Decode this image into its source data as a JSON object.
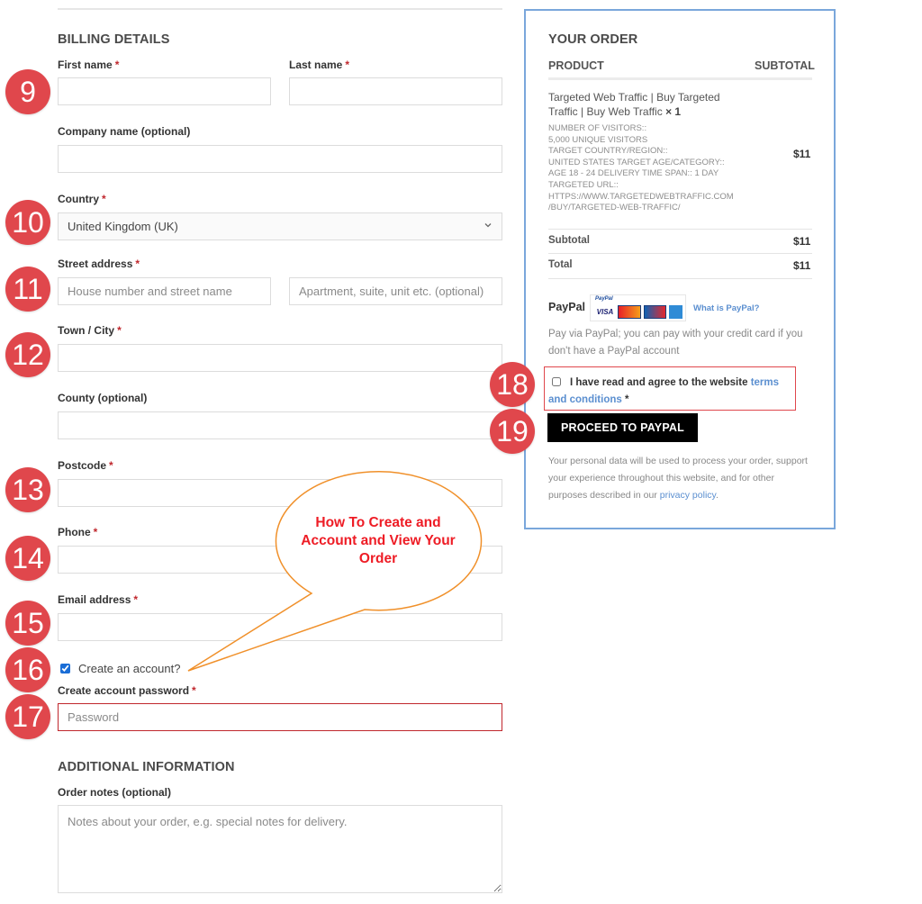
{
  "billing": {
    "heading": "BILLING DETAILS",
    "required_mark": "*",
    "first_name": {
      "label": "First name",
      "value": "",
      "placeholder": ""
    },
    "last_name": {
      "label": "Last name",
      "value": "",
      "placeholder": ""
    },
    "company": {
      "label": "Company name (optional)",
      "value": ""
    },
    "country": {
      "label": "Country",
      "selected": "United Kingdom (UK)"
    },
    "street": {
      "label": "Street address",
      "line1_placeholder": "House number and street name",
      "line2_placeholder": "Apartment, suite, unit etc. (optional)"
    },
    "town": {
      "label": "Town / City",
      "value": ""
    },
    "county": {
      "label": "County (optional)",
      "value": ""
    },
    "postcode": {
      "label": "Postcode",
      "value": ""
    },
    "phone": {
      "label": "Phone",
      "value": ""
    },
    "email": {
      "label": "Email address",
      "value": ""
    },
    "create_account": {
      "label": "Create an account?",
      "checked": true
    },
    "password": {
      "label": "Create account password",
      "placeholder": "Password"
    }
  },
  "additional": {
    "heading": "ADDITIONAL INFORMATION",
    "notes_label": "Order notes (optional)",
    "notes_placeholder": "Notes about your order, e.g. special notes for delivery."
  },
  "order": {
    "heading": "YOUR ORDER",
    "col_product": "PRODUCT",
    "col_subtotal": "SUBTOTAL",
    "product_name": "Targeted Web Traffic | Buy Targeted Traffic | Buy Web Traffic",
    "quantity": "× 1",
    "product_meta": "NUMBER OF VISITORS::\n5,000 UNIQUE VISITORS\nTARGET COUNTRY/REGION::\nUNITED STATES   TARGET AGE/CATEGORY::\nAGE 18 - 24   DELIVERY TIME SPAN::   1 DAY\nTARGETED URL::\nHTTPS://WWW.TARGETEDWEBTRAFFIC.COM\n/BUY/TARGETED-WEB-TRAFFIC/",
    "line_price": "$11",
    "subtotal_label": "Subtotal",
    "subtotal_value": "$11",
    "total_label": "Total",
    "total_value": "$11"
  },
  "payment": {
    "method": "PayPal",
    "logo_mark": "PayPal",
    "cards": [
      "VISA",
      "MasterCard",
      "Maestro",
      "AMEX"
    ],
    "what_is_link": "What is PayPal?",
    "description": "Pay via PayPal; you can pay with your credit card if you don't have a PayPal account"
  },
  "terms": {
    "text": "I have read and agree to the website",
    "link": "terms and conditions",
    "required_mark": "*",
    "checked": false
  },
  "proceed_button": "PROCEED TO PAYPAL",
  "privacy": {
    "text": "Your personal data will be used to process your order, support your experience throughout this website, and for other purposes described in our",
    "link": "privacy policy",
    "end": "."
  },
  "annotations": {
    "steps": [
      "9",
      "10",
      "11",
      "12",
      "13",
      "14",
      "15",
      "16",
      "17",
      "18",
      "19"
    ],
    "callout_text": "How To Create and Account and View Your Order",
    "badge_color": "#e0474c",
    "callout_border_color": "#f0902a",
    "callout_text_color": "#ee1c25"
  },
  "colors": {
    "order_box_border": "#7aa7db",
    "link": "#5b8fd0",
    "error_border": "#c0272d"
  }
}
